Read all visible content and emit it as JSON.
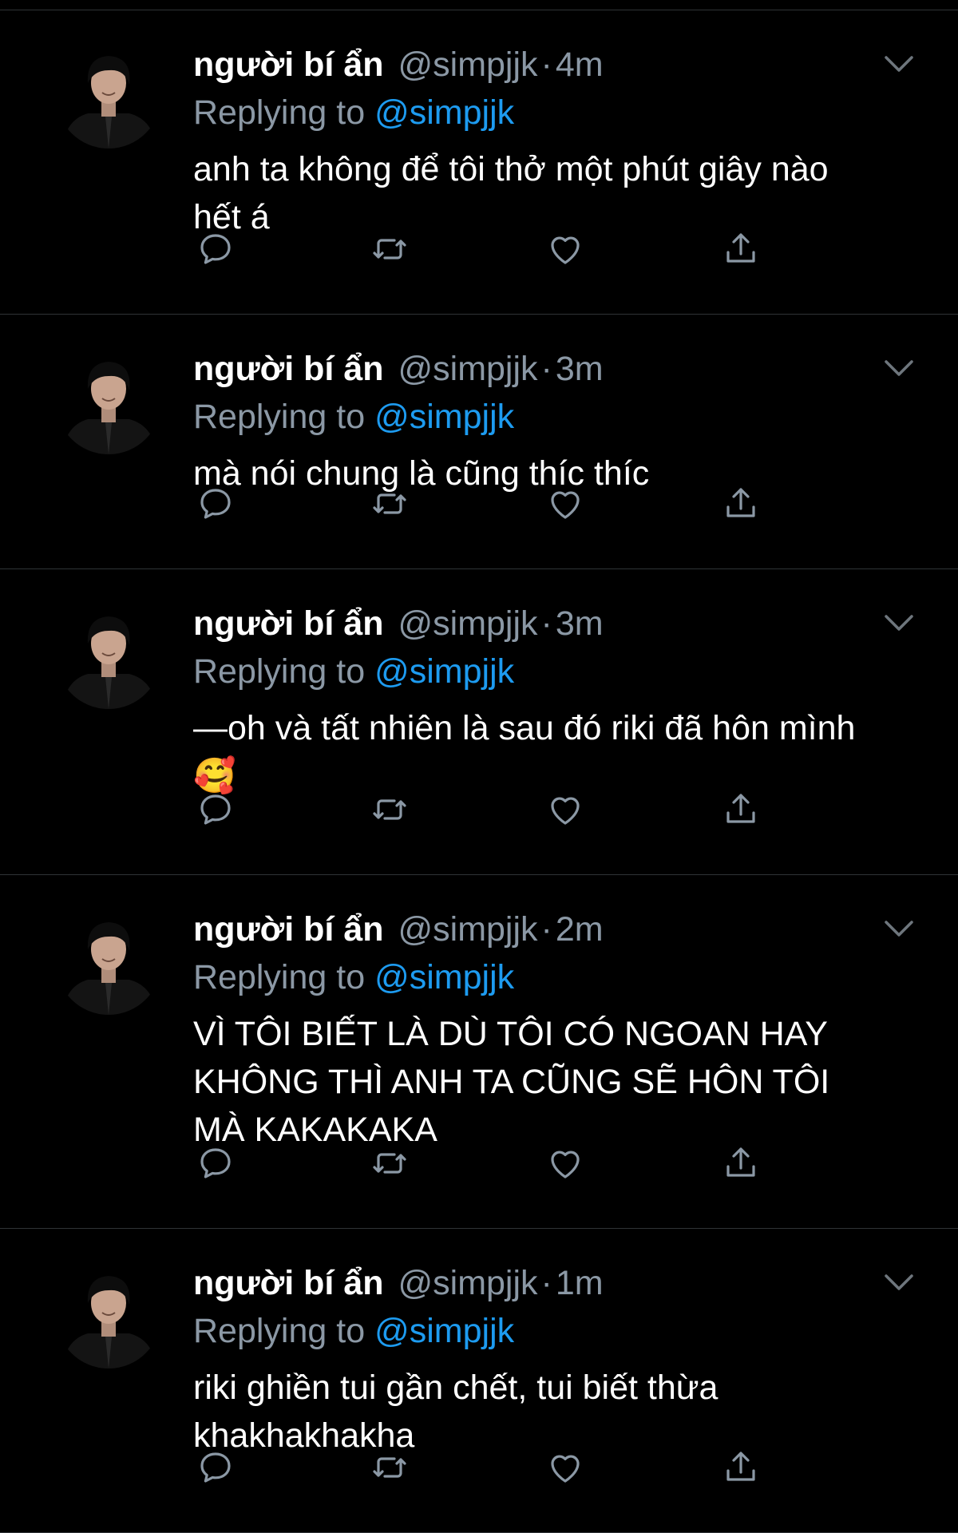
{
  "colors": {
    "background": "#000000",
    "text": "#ffffff",
    "muted": "#8b98a5",
    "link": "#1d9bf0",
    "divider": "#2f3336"
  },
  "icons": {
    "menu": "chevron-down-icon",
    "reply": "reply-icon",
    "retweet": "retweet-icon",
    "like": "heart-icon",
    "share": "share-icon"
  },
  "tweets": [
    {
      "name": "người bí ẩn",
      "handle": "@simpjjk",
      "separator": "·",
      "time": "4m",
      "replying_label": "Replying to",
      "replying_to": "@simpjjk",
      "lines": [
        "anh ta không để tôi thở một phút giây nào",
        "hết á"
      ]
    },
    {
      "name": "người bí ẩn",
      "handle": "@simpjjk",
      "separator": "·",
      "time": "3m",
      "replying_label": "Replying to",
      "replying_to": "@simpjjk",
      "lines": [
        "mà nói chung là cũng thíc thíc"
      ]
    },
    {
      "name": "người bí ẩn",
      "handle": "@simpjjk",
      "separator": "·",
      "time": "3m",
      "replying_label": "Replying to",
      "replying_to": "@simpjjk",
      "lines": [
        "—oh và tất nhiên là sau đó riki đã hôn mình",
        "🥰"
      ]
    },
    {
      "name": "người bí ẩn",
      "handle": "@simpjjk",
      "separator": "·",
      "time": "2m",
      "replying_label": "Replying to",
      "replying_to": "@simpjjk",
      "lines": [
        "VÌ TÔI BIẾT LÀ DÙ TÔI CÓ NGOAN HAY",
        "KHÔNG THÌ ANH TA CŨNG SẼ HÔN TÔI",
        "MÀ KAKAKAKA"
      ]
    },
    {
      "name": "người bí ẩn",
      "handle": "@simpjjk",
      "separator": "·",
      "time": "1m",
      "replying_label": "Replying to",
      "replying_to": "@simpjjk",
      "lines": [
        "riki ghiền tui gần chết, tui biết thừa",
        "khakhakhakha"
      ]
    }
  ]
}
